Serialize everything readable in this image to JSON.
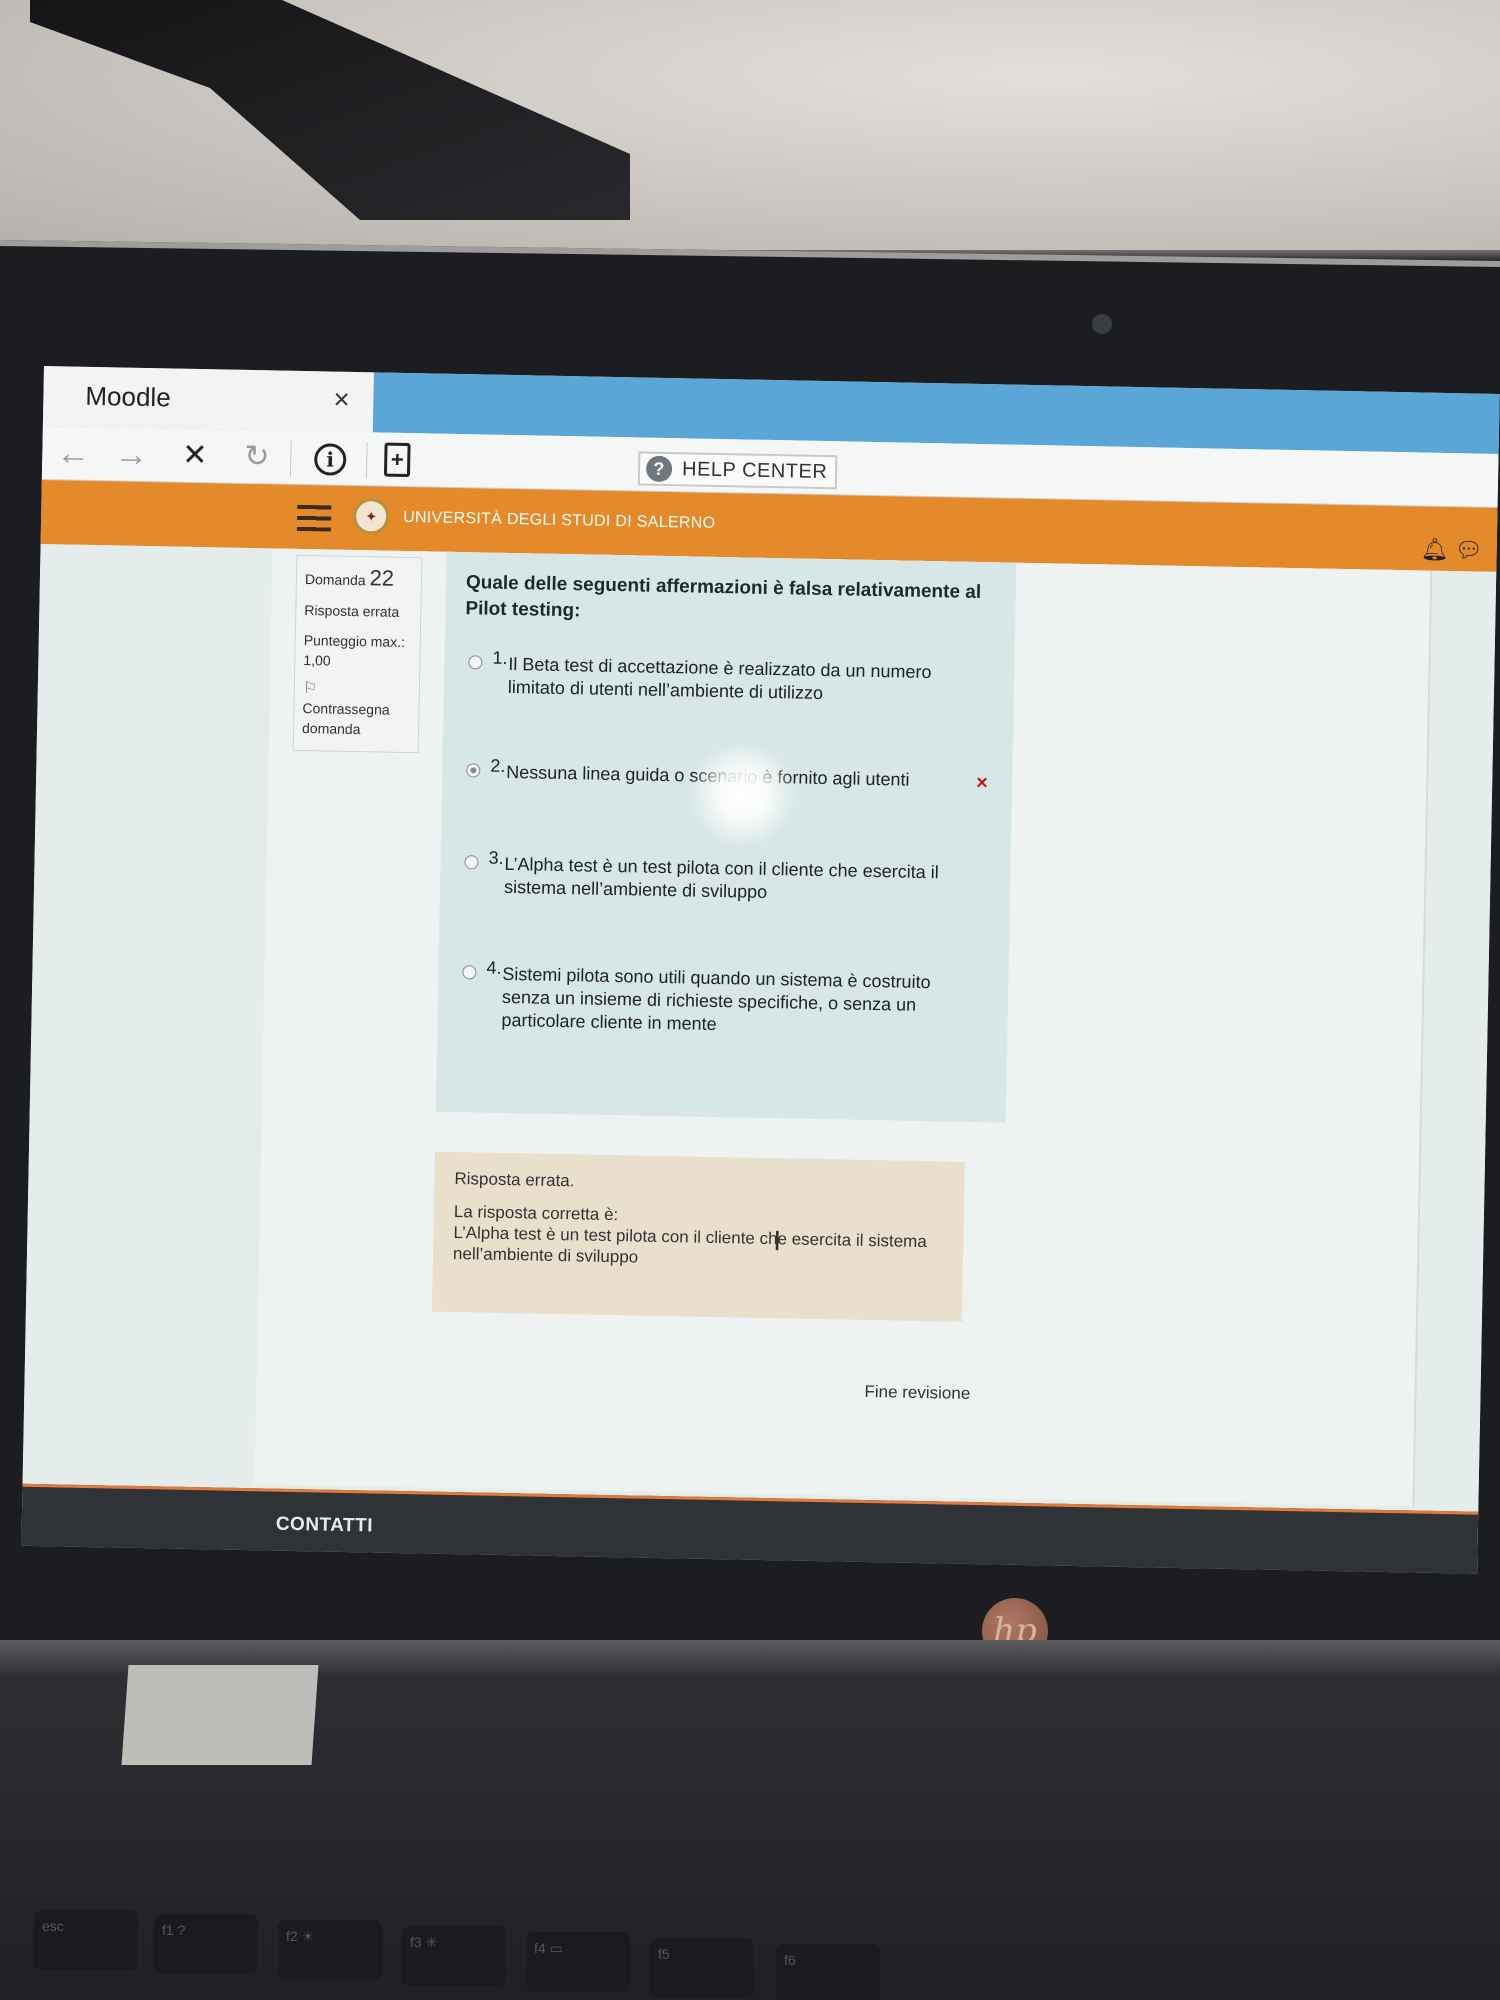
{
  "browser": {
    "tab_title": "Moodle",
    "tab_close": "×",
    "nav": {
      "back": "←",
      "forward": "→",
      "stop": "✕",
      "reload": "↻",
      "info": "i",
      "page": "+"
    },
    "help_center": {
      "icon": "?",
      "label": "HELP CENTER"
    }
  },
  "header": {
    "university": "UNIVERSITÀ DEGLI STUDI DI SALERNO",
    "icons": [
      "menu-icon",
      "bell-icon",
      "chat-icon"
    ]
  },
  "question_info": {
    "label": "Domanda",
    "number": "22",
    "state": "Risposta errata",
    "max_score_label": "Punteggio max.:",
    "max_score_value": "1,00",
    "flag_label": "Contrassegna domanda"
  },
  "question": {
    "text": "Quale delle seguenti affermazioni è falsa relativamente al Pilot testing:",
    "answers": [
      {
        "num": "1.",
        "text": "Il Beta test di accettazione è realizzato da un numero limitato di utenti nell’ambiente di utilizzo",
        "selected": false
      },
      {
        "num": "2.",
        "text": "Nessuna linea guida o scenario è fornito agli utenti",
        "selected": true,
        "mark": "×"
      },
      {
        "num": "3.",
        "text": "L’Alpha test è un test pilota con il cliente che esercita il sistema nell’ambiente di sviluppo",
        "selected": false
      },
      {
        "num": "4.",
        "text": "Sistemi pilota sono utili quando un sistema è costruito senza un insieme di richieste specifiche, o senza un particolare cliente in mente",
        "selected": false
      }
    ]
  },
  "feedback": {
    "result": "Risposta errata.",
    "correct_label": "La risposta corretta è:",
    "correct_answer": "L’Alpha test è un test pilota con il cliente che esercita il sistema nell’ambiente di sviluppo"
  },
  "finish_review": "Fine revisione",
  "footer": {
    "contacts": "CONTATTI"
  },
  "colors": {
    "header_orange": "#e48a2b",
    "tab_blue": "#5aa6d6",
    "wrong_red": "#b82020",
    "footer": "#2f3237"
  }
}
